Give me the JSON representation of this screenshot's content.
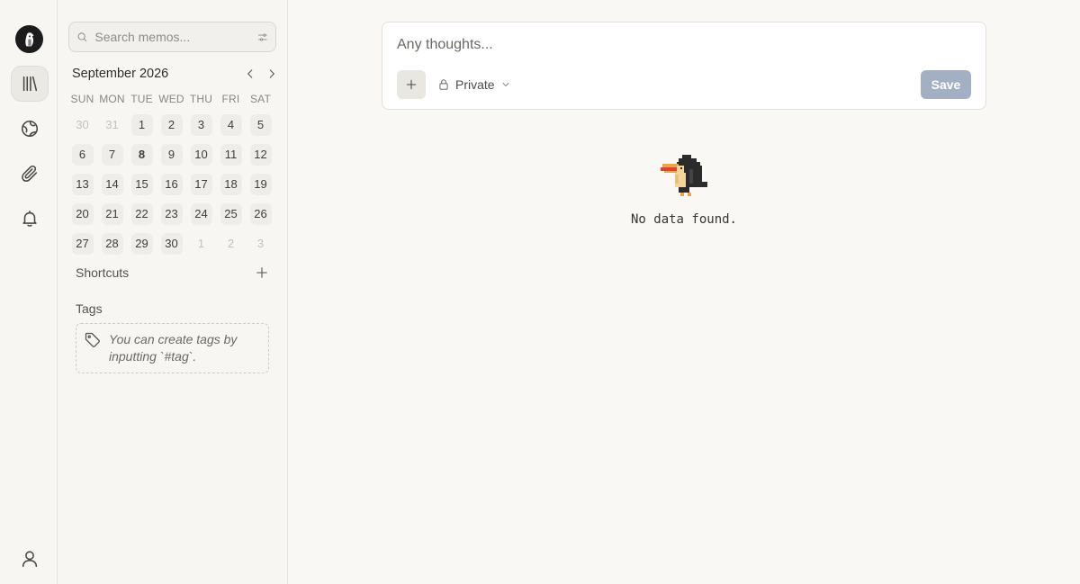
{
  "search": {
    "placeholder": "Search memos..."
  },
  "calendar": {
    "title": "September 2026",
    "weekdays": [
      "SUN",
      "MON",
      "TUE",
      "WED",
      "THU",
      "FRI",
      "SAT"
    ],
    "days": [
      {
        "n": "30",
        "muted": true
      },
      {
        "n": "31",
        "muted": true
      },
      {
        "n": "1"
      },
      {
        "n": "2"
      },
      {
        "n": "3"
      },
      {
        "n": "4"
      },
      {
        "n": "5"
      },
      {
        "n": "6"
      },
      {
        "n": "7"
      },
      {
        "n": "8",
        "today": true
      },
      {
        "n": "9"
      },
      {
        "n": "10"
      },
      {
        "n": "11"
      },
      {
        "n": "12"
      },
      {
        "n": "13"
      },
      {
        "n": "14"
      },
      {
        "n": "15"
      },
      {
        "n": "16"
      },
      {
        "n": "17"
      },
      {
        "n": "18"
      },
      {
        "n": "19"
      },
      {
        "n": "20"
      },
      {
        "n": "21"
      },
      {
        "n": "22"
      },
      {
        "n": "23"
      },
      {
        "n": "24"
      },
      {
        "n": "25"
      },
      {
        "n": "26"
      },
      {
        "n": "27"
      },
      {
        "n": "28"
      },
      {
        "n": "29"
      },
      {
        "n": "30"
      },
      {
        "n": "1",
        "muted": true
      },
      {
        "n": "2",
        "muted": true
      },
      {
        "n": "3",
        "muted": true
      }
    ]
  },
  "sidebar": {
    "shortcuts_label": "Shortcuts",
    "tags_label": "Tags",
    "tags_empty": "You can create tags by inputting `#tag`."
  },
  "editor": {
    "placeholder": "Any thoughts...",
    "visibility": "Private",
    "save_label": "Save"
  },
  "empty": {
    "text": "No data found."
  },
  "colors": {
    "save_button": "#a3b0c4",
    "background": "#f9f8f5"
  }
}
